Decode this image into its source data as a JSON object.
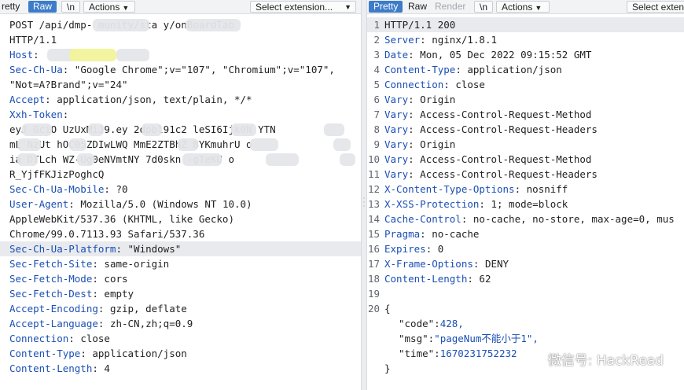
{
  "request": {
    "tabs": [
      "retty",
      "Raw",
      "\\n",
      "Actions"
    ],
    "selected_tab": "Raw",
    "select_extension": "Select extension...",
    "lines": [
      {
        "text": "POST /api/dmp-           munity/sta        y/onBoardTab"
      },
      {
        "text": "HTTP/1.1"
      },
      {
        "key": "Host",
        "value": ""
      },
      {
        "key": "Sec-Ch-Ua",
        "value": "\"Google Chrome\";v=\"107\", \"Chromium\";v=\"107\","
      },
      {
        "text": "\"Not=A?Brand\";v=\"24\""
      },
      {
        "key": "Accept",
        "value": "application/json, text/plain, */*"
      },
      {
        "key": "Xxh-Token",
        "value": ""
      },
      {
        "text": "eyJ   GciO  UzUxMiJ9.ey    2dpbl91c2     leSI6Ijk0N    YTN"
      },
      {
        "text": "mL  NzUt    hOC05ZDIwLWQ      MmE2ZTBhZ      BYKmuhrU     o"
      },
      {
        "text": "ia   DTLch   WZ-Ug0eNVmtNY        7d0skn      -gTeKU    o"
      },
      {
        "text": "R_YjfFKJizPoghcQ"
      },
      {
        "key": "Sec-Ch-Ua-Mobile",
        "value": "?0"
      },
      {
        "key": "User-Agent",
        "value": "Mozilla/5.0 (Windows NT 10.0)"
      },
      {
        "text": "AppleWebKit/537.36 (KHTML, like Gecko)"
      },
      {
        "text": "Chrome/99.0.7113.93 Safari/537.36"
      },
      {
        "key": "Sec-Ch-Ua-Platform",
        "value": "\"Windows\"",
        "highlight": true
      },
      {
        "key": "Sec-Fetch-Site",
        "value": "same-origin"
      },
      {
        "key": "Sec-Fetch-Mode",
        "value": "cors"
      },
      {
        "key": "Sec-Fetch-Dest",
        "value": "empty"
      },
      {
        "key": "Accept-Encoding",
        "value": "gzip, deflate"
      },
      {
        "key": "Accept-Language",
        "value": "zh-CN,zh;q=0.9"
      },
      {
        "key": "Connection",
        "value": "close"
      },
      {
        "key": "Content-Type",
        "value": "application/json"
      },
      {
        "key": "Content-Length",
        "value": "4"
      },
      {
        "text": ""
      },
      {
        "text": "{}"
      }
    ]
  },
  "response": {
    "tabs": [
      "Pretty",
      "Raw",
      "Render",
      "\\n",
      "Actions"
    ],
    "selected_tab": "Pretty",
    "select_extension": "Select extens",
    "lines": [
      {
        "n": "1",
        "text": "HTTP/1.1 200",
        "highlight": true
      },
      {
        "n": "2",
        "key": "Server",
        "value": "nginx/1.8.1"
      },
      {
        "n": "3",
        "key": "Date",
        "value": "Mon, 05 Dec 2022 09:15:52 GMT"
      },
      {
        "n": "4",
        "key": "Content-Type",
        "value": "application/json"
      },
      {
        "n": "5",
        "key": "Connection",
        "value": "close"
      },
      {
        "n": "6",
        "key": "Vary",
        "value": "Origin"
      },
      {
        "n": "7",
        "key": "Vary",
        "value": "Access-Control-Request-Method"
      },
      {
        "n": "8",
        "key": "Vary",
        "value": "Access-Control-Request-Headers"
      },
      {
        "n": "9",
        "key": "Vary",
        "value": "Origin"
      },
      {
        "n": "10",
        "key": "Vary",
        "value": "Access-Control-Request-Method"
      },
      {
        "n": "11",
        "key": "Vary",
        "value": "Access-Control-Request-Headers"
      },
      {
        "n": "12",
        "key": "X-Content-Type-Options",
        "value": "nosniff"
      },
      {
        "n": "13",
        "key": "X-XSS-Protection",
        "value": "1; mode=block"
      },
      {
        "n": "14",
        "key": "Cache-Control",
        "value": "no-cache, no-store, max-age=0, mus"
      },
      {
        "n": "15",
        "key": "Pragma",
        "value": "no-cache"
      },
      {
        "n": "16",
        "key": "Expires",
        "value": "0"
      },
      {
        "n": "17",
        "key": "X-Frame-Options",
        "value": "DENY"
      },
      {
        "n": "18",
        "key": "Content-Length",
        "value": "62"
      },
      {
        "n": "19",
        "text": ""
      },
      {
        "n": "20",
        "text": "{"
      }
    ],
    "json_body": [
      {
        "k": "\"code\"",
        "v": "428,"
      },
      {
        "k": "\"msg\"",
        "v": "\"pageNum不能小于1\","
      },
      {
        "k": "\"time\"",
        "v": "1670231752232"
      }
    ],
    "close_brace": "}"
  },
  "watermark": "微信号: HackRead"
}
